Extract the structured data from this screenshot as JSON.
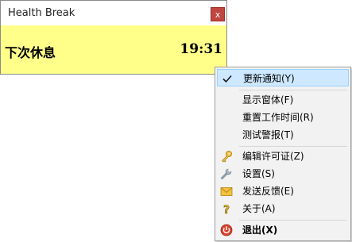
{
  "window": {
    "title": "Health Break",
    "close_label": "x",
    "next_break_label": "下次休息",
    "next_break_time": "19:31",
    "panel_color": "#ffff8a"
  },
  "menu": {
    "items": [
      {
        "label": "更新通知(Y)",
        "checked": true,
        "icon": "check-icon"
      },
      {
        "label": "显示窗体(F)"
      },
      {
        "label": "重置工作时间(R)"
      },
      {
        "label": "测试警报(T)"
      },
      {
        "label": "编辑许可证(Z)",
        "icon": "key-icon"
      },
      {
        "label": "设置(S)",
        "icon": "wrench-icon"
      },
      {
        "label": "发送反馈(E)",
        "icon": "envelope-icon"
      },
      {
        "label": "关于(A)",
        "icon": "question-icon"
      },
      {
        "label": "退出(X)",
        "icon": "power-icon"
      }
    ],
    "highlight_color": "#cde8ff"
  }
}
